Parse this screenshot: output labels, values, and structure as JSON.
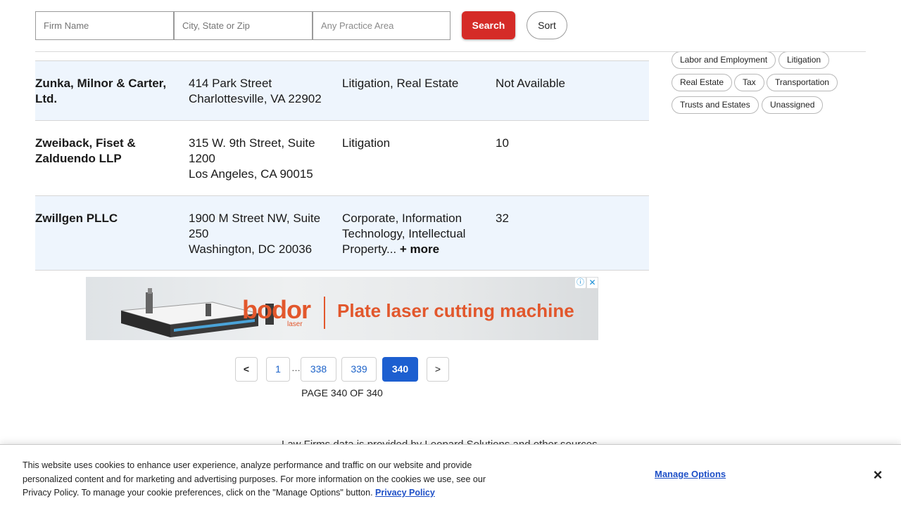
{
  "search": {
    "firm_placeholder": "Firm Name",
    "location_placeholder": "City, State or Zip",
    "practice_placeholder": "Any Practice Area",
    "search_label": "Search",
    "sort_label": "Sort"
  },
  "results": [
    {
      "name": "Zunka, Milnor & Carter, Ltd.",
      "address_line1": "414 Park Street",
      "address_line2": "Charlottesville, VA 22902",
      "practice": "Litigation, Real Estate",
      "size": "Not Available"
    },
    {
      "name": "Zweiback, Fiset & Zalduendo LLP",
      "address_line1": "315 W. 9th Street, Suite 1200",
      "address_line2": "Los Angeles, CA 90015",
      "practice": "Litigation",
      "size": "10"
    },
    {
      "name": "Zwillgen PLLC",
      "address_line1": "1900 M Street NW, Suite 250",
      "address_line2": "Washington, DC 20036",
      "practice": "Corporate, Information Technology, Intellectual Property...",
      "more_label": "+ more",
      "size": "32"
    }
  ],
  "ad": {
    "brand": "bodor",
    "brand_sub": "laser",
    "tagline": "Plate laser cutting machine",
    "adchoices_icon": "ⓘ",
    "close_icon": "✕"
  },
  "pagination": {
    "prev": "<",
    "pages": [
      "1",
      "338",
      "339",
      "340"
    ],
    "ellipsis": "…",
    "next": ">",
    "current": "340",
    "status": "PAGE 340 OF 340"
  },
  "footer": {
    "provided_by": "Law Firms data is provided by Leopard Solutions and other sources."
  },
  "practice_chips": [
    "Labor and Employment",
    "Litigation",
    "Real Estate",
    "Tax",
    "Transportation",
    "Trusts and Estates",
    "Unassigned"
  ],
  "cookie": {
    "text": "This website uses cookies to enhance user experience, analyze performance and traffic on our website and provide personalized content and for marketing and advertising purposes. For more information on the cookies we use, see our Privacy Policy. To manage your cookie preferences, click on the \"Manage Options\" button.",
    "policy_link": "Privacy Policy",
    "manage_label": "Manage Options",
    "close_icon": "×"
  },
  "colors": {
    "search_button": "#d52b27",
    "active_page": "#1d5fd0",
    "row_alt": "#eef5fd",
    "link": "#1d4fc7",
    "ad_brand": "#e2572c"
  }
}
